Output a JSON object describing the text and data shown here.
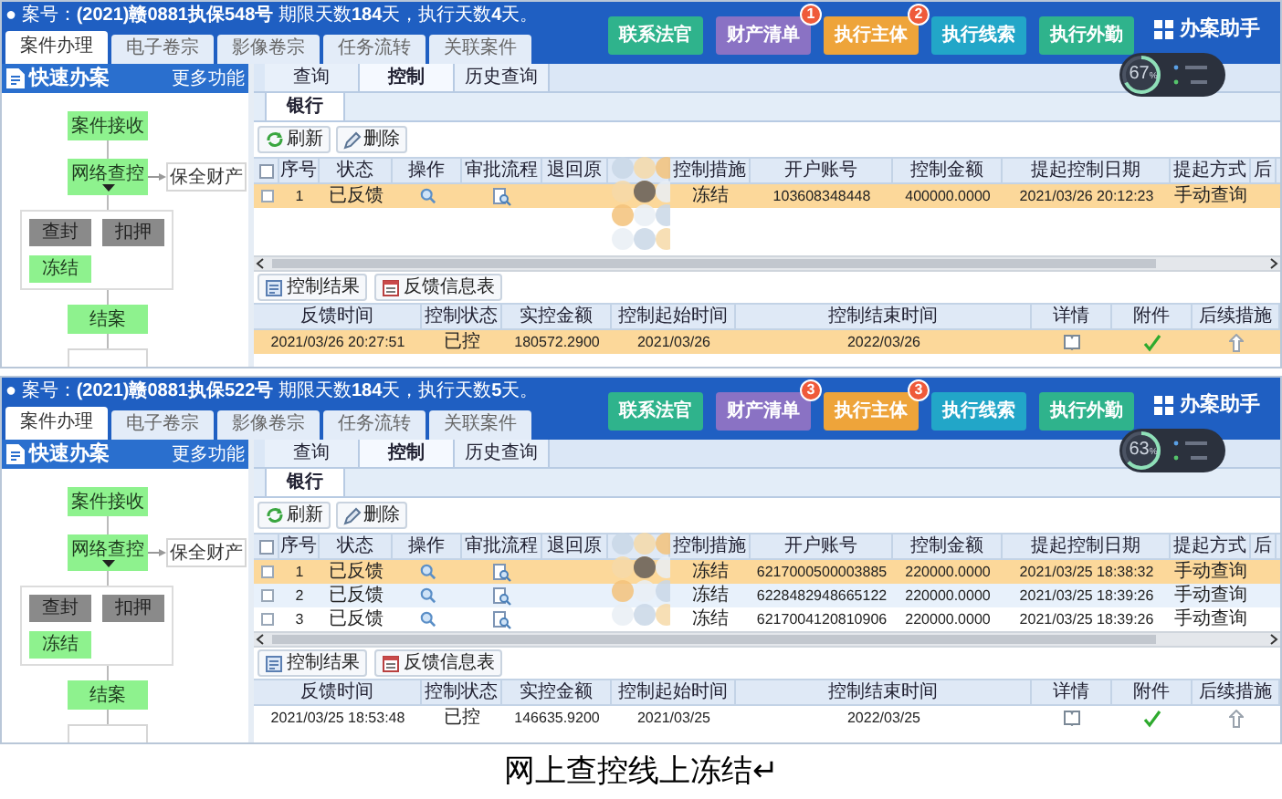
{
  "panels": [
    {
      "case_line": "● 案号：**(2021)赣0881执保548号** 期限天数**184**天，执行天数**4**天。",
      "tabs": [
        {
          "label": "案件办理",
          "selected": true
        },
        {
          "label": "电子卷宗",
          "selected": false
        },
        {
          "label": "影像卷宗",
          "selected": false
        },
        {
          "label": "任务流转",
          "selected": false
        },
        {
          "label": "关联案件",
          "selected": false
        }
      ],
      "actions": [
        {
          "label": "联系法官",
          "color": "#2fb38c"
        },
        {
          "label": "财产清单",
          "color": "#8a72c4",
          "badge": "1"
        },
        {
          "label": "执行主体",
          "color": "#eea43a",
          "badge": "2"
        },
        {
          "label": "执行线索",
          "color": "#22a6c8"
        },
        {
          "label": "执行外勤",
          "color": "#2fb38c"
        }
      ],
      "assistant": "办案助手",
      "gauge": {
        "reading": "67",
        "unit": "%",
        "level": 0.67
      },
      "quick_panel": {
        "title": "快速办案",
        "link": "更多功能"
      },
      "flow": [
        {
          "label": "案件接收",
          "kind": "done"
        },
        {
          "label": "网络查控",
          "kind": "done"
        },
        {
          "label": "保全财产",
          "kind": "plain"
        },
        {
          "label": "查封",
          "kind": "blocked"
        },
        {
          "label": "扣押",
          "kind": "blocked"
        },
        {
          "label": "冻结",
          "kind": "done"
        },
        {
          "label": "结案",
          "kind": "done"
        }
      ],
      "control_tabs": [
        {
          "label": "查询",
          "selected": false
        },
        {
          "label": "控制",
          "selected": true
        },
        {
          "label": "历史查询",
          "selected": false
        }
      ],
      "bank_tabs": [
        {
          "label": "银行",
          "selected": true
        }
      ],
      "toolbar": [
        "刷新",
        "删除"
      ],
      "table": {
        "select_all": {
          "checked": false
        },
        "columns": [
          "序号",
          "状态",
          "操作",
          "审批流程",
          "退回原",
          "控制措施",
          "开户账号",
          "控制金额",
          "提起控制日期",
          "提起方式",
          "后"
        ],
        "rows": [
          {
            "selected": true,
            "checked": false,
            "no": "1",
            "status": "已反馈",
            "measure": "冻结",
            "account": "103608348448",
            "amount": "400000.0000",
            "date": "2021/03/26 20:12:23",
            "method": "手动查询"
          }
        ]
      },
      "result_toolbar": [
        "控制结果",
        "反馈信息表"
      ],
      "result_table": {
        "columns": [
          "反馈时间",
          "控制状态",
          "实控金额",
          "控制起始时间",
          "控制结束时间",
          "详情",
          "附件",
          "后续措施"
        ],
        "rows": [
          {
            "selected": true,
            "time": "2021/03/26 20:27:51",
            "status": "已控",
            "amount": "180572.2900",
            "start": "2021/03/26",
            "end": "2022/03/26"
          }
        ]
      }
    },
    {
      "case_line": "● 案号：**(2021)赣0881执保522号** 期限天数**184**天，执行天数**5**天。",
      "tabs": [
        {
          "label": "案件办理",
          "selected": true
        },
        {
          "label": "电子卷宗",
          "selected": false
        },
        {
          "label": "影像卷宗",
          "selected": false
        },
        {
          "label": "任务流转",
          "selected": false
        },
        {
          "label": "关联案件",
          "selected": false
        }
      ],
      "actions": [
        {
          "label": "联系法官",
          "color": "#2fb38c"
        },
        {
          "label": "财产清单",
          "color": "#8a72c4",
          "badge": "3"
        },
        {
          "label": "执行主体",
          "color": "#eea43a",
          "badge": "3"
        },
        {
          "label": "执行线索",
          "color": "#22a6c8"
        },
        {
          "label": "执行外勤",
          "color": "#2fb38c"
        }
      ],
      "assistant": "办案助手",
      "gauge": {
        "reading": "63",
        "unit": "%",
        "level": 0.63
      },
      "quick_panel": {
        "title": "快速办案",
        "link": "更多功能"
      },
      "flow": [
        {
          "label": "案件接收",
          "kind": "done"
        },
        {
          "label": "网络查控",
          "kind": "done"
        },
        {
          "label": "保全财产",
          "kind": "plain"
        },
        {
          "label": "查封",
          "kind": "blocked"
        },
        {
          "label": "扣押",
          "kind": "blocked"
        },
        {
          "label": "冻结",
          "kind": "done"
        },
        {
          "label": "结案",
          "kind": "done"
        }
      ],
      "control_tabs": [
        {
          "label": "查询",
          "selected": false
        },
        {
          "label": "控制",
          "selected": true
        },
        {
          "label": "历史查询",
          "selected": false
        }
      ],
      "bank_tabs": [
        {
          "label": "银行",
          "selected": true
        }
      ],
      "toolbar": [
        "刷新",
        "删除"
      ],
      "table": {
        "select_all": {
          "checked": false
        },
        "columns": [
          "序号",
          "状态",
          "操作",
          "审批流程",
          "退回原",
          "控制措施",
          "开户账号",
          "控制金额",
          "提起控制日期",
          "提起方式",
          "后"
        ],
        "rows": [
          {
            "selected": true,
            "checked": false,
            "no": "1",
            "status": "已反馈",
            "measure": "冻结",
            "account": "6217000500003885",
            "amount": "220000.0000",
            "date": "2021/03/25 18:38:32",
            "method": "手动查询"
          },
          {
            "selected": false,
            "checked": false,
            "no": "2",
            "status": "已反馈",
            "measure": "冻结",
            "account": "6228482948665122",
            "amount": "220000.0000",
            "date": "2021/03/25 18:39:26",
            "method": "手动查询"
          },
          {
            "selected": false,
            "checked": false,
            "no": "3",
            "status": "已反馈",
            "measure": "冻结",
            "account": "6217004120810906",
            "amount": "220000.0000",
            "date": "2021/03/25 18:39:26",
            "method": "手动查询"
          }
        ]
      },
      "result_toolbar": [
        "控制结果",
        "反馈信息表"
      ],
      "result_table": {
        "columns": [
          "反馈时间",
          "控制状态",
          "实控金额",
          "控制起始时间",
          "控制结束时间",
          "详情",
          "附件",
          "后续措施"
        ],
        "rows": [
          {
            "selected": false,
            "time": "2021/03/25 18:53:48",
            "status": "已控",
            "amount": "146635.9200",
            "start": "2021/03/25",
            "end": "2022/03/25"
          }
        ]
      }
    }
  ],
  "caption": "网上查控线上冻结↵"
}
